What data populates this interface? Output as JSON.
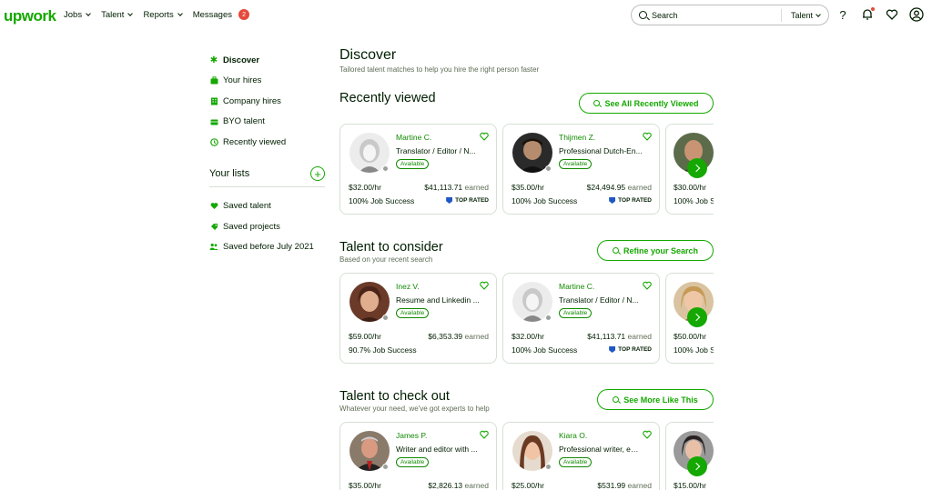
{
  "header": {
    "logo": "upwork",
    "nav": [
      {
        "label": "Jobs",
        "dropdown": true
      },
      {
        "label": "Talent",
        "dropdown": true
      },
      {
        "label": "Reports",
        "dropdown": true
      },
      {
        "label": "Messages",
        "dropdown": false,
        "badge": "2"
      }
    ],
    "search": {
      "placeholder": "Search",
      "scope": "Talent"
    },
    "icons": [
      "help-icon",
      "notification-bell-icon",
      "heart-icon",
      "user-avatar-icon"
    ]
  },
  "sidebar": {
    "items": [
      {
        "label": "Discover",
        "icon": "asterisk-icon",
        "active": true
      },
      {
        "label": "Your hires",
        "icon": "briefcase-icon"
      },
      {
        "label": "Company hires",
        "icon": "building-icon"
      },
      {
        "label": "BYO talent",
        "icon": "suitcase-icon"
      },
      {
        "label": "Recently viewed",
        "icon": "history-icon"
      }
    ],
    "lists_title": "Your lists",
    "lists": [
      {
        "label": "Saved talent",
        "icon": "heart-filled-icon"
      },
      {
        "label": "Saved projects",
        "icon": "tag-icon"
      },
      {
        "label": "Saved before July 2021",
        "icon": "people-icon"
      }
    ]
  },
  "main": {
    "title": "Discover",
    "subtitle": "Tailored talent matches to help you hire the right person faster",
    "sections": [
      {
        "title": "Recently viewed",
        "subtitle": "",
        "button": "See All Recently Viewed",
        "cards": [
          {
            "name": "Martine C.",
            "title": "Translator / Editor / N...",
            "availability": "Available",
            "rate": "$32.00/hr",
            "earned": "$41,113.71",
            "earned_label": "earned",
            "job_success": "100% Job Success",
            "badge": "TOP RATED",
            "avatar": "blonde"
          },
          {
            "name": "Thijmen Z.",
            "title": "Professional Dutch-En...",
            "availability": "Available",
            "rate": "$35.00/hr",
            "earned": "$24,494.95",
            "earned_label": "earned",
            "job_success": "100% Job Success",
            "badge": "TOP RATED",
            "avatar": "dark-hair"
          }
        ],
        "partial": {
          "rate": "$30.00/hr",
          "job_success": "100% Job S"
        }
      },
      {
        "title": "Talent to consider",
        "subtitle": "Based on your recent search",
        "button": "Refine your Search",
        "cards": [
          {
            "name": "Inez V.",
            "title": "Resume and Linkedin ...",
            "availability": "Available",
            "rate": "$59.00/hr",
            "earned": "$6,353.39",
            "earned_label": "earned",
            "job_success": "90.7% Job Success",
            "badge": "",
            "avatar": "brunette"
          },
          {
            "name": "Martine C.",
            "title": "Translator / Editor / N...",
            "availability": "Available",
            "rate": "$32.00/hr",
            "earned": "$41,113.71",
            "earned_label": "earned",
            "job_success": "100% Job Success",
            "badge": "TOP RATED",
            "avatar": "blonde"
          }
        ],
        "partial": {
          "rate": "$50.00/hr",
          "job_success": "100% Job S"
        }
      },
      {
        "title": "Talent to check out",
        "subtitle": "Whatever your need, we've got experts to help",
        "button": "See More Like This",
        "cards": [
          {
            "name": "James P.",
            "title": "Writer and editor with ...",
            "availability": "Available",
            "rate": "$35.00/hr",
            "earned": "$2,826.13",
            "earned_label": "earned",
            "job_success": "",
            "badge": "",
            "avatar": "man-suit"
          },
          {
            "name": "Kiara O.",
            "title": "Professional writer, edi...",
            "availability": "Available",
            "rate": "$25.00/hr",
            "earned": "$531.99",
            "earned_label": "earned",
            "job_success": "",
            "badge": "",
            "avatar": "long-hair"
          }
        ],
        "partial": {
          "rate": "$15.00/hr",
          "job_success": ""
        }
      }
    ]
  },
  "colors": {
    "brand": "#14a800",
    "link": "#108a00",
    "text": "#001e00",
    "muted": "#5e6d55",
    "badge": "#e54a3c",
    "top_rated": "#1f57c3"
  }
}
